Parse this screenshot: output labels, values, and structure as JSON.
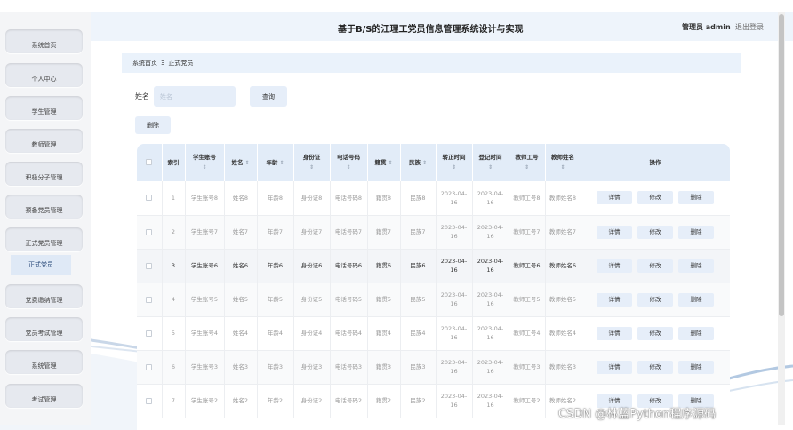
{
  "header": {
    "title": "基于B/S的江理工党员信息管理系统设计与实现",
    "admin": "管理员 admin",
    "logout": "退出登录"
  },
  "sidebar": {
    "items": [
      {
        "label": "系统首页"
      },
      {
        "label": "个人中心"
      },
      {
        "label": "学生管理"
      },
      {
        "label": "教师管理"
      },
      {
        "label": "积极分子管理"
      },
      {
        "label": "预备党员管理"
      },
      {
        "label": "正式党员管理"
      },
      {
        "label": "党费缴纳管理"
      },
      {
        "label": "党员考试管理"
      },
      {
        "label": "系统管理"
      },
      {
        "label": "考试管理"
      }
    ],
    "submenu_label": "正式党员"
  },
  "breadcrumb": {
    "home": "系统首页",
    "separator": "Ξ",
    "current": "正式党员"
  },
  "search": {
    "label": "姓名",
    "placeholder": "姓名",
    "query_button": "查询",
    "delete_button": "删除"
  },
  "table": {
    "headers": {
      "index": "索引",
      "student_no": "学生账号",
      "name": "姓名",
      "age": "年龄",
      "id_card": "身份证",
      "phone": "电话号码",
      "native": "籍贯",
      "ethnic": "民族",
      "cert_time": "转正时间",
      "reg_time": "登记时间",
      "teacher_no": "教师工号",
      "teacher_name": "教师姓名",
      "ops": "操作"
    },
    "sort_glyph": "⇕",
    "op_labels": {
      "detail": "详情",
      "edit": "修改",
      "delete": "删除"
    },
    "rows": [
      {
        "index": "1",
        "student_no": "学生账号8",
        "name": "姓名8",
        "age": "年龄8",
        "id_card": "身份证8",
        "phone": "电话号码8",
        "native": "籍贯8",
        "ethnic": "民族8",
        "cert_time": "2023-04-16",
        "reg_time": "2023-04-16",
        "teacher_no": "教师工号8",
        "teacher_name": "教师姓名8"
      },
      {
        "index": "2",
        "student_no": "学生账号7",
        "name": "姓名7",
        "age": "年龄7",
        "id_card": "身份证7",
        "phone": "电话号码7",
        "native": "籍贯7",
        "ethnic": "民族7",
        "cert_time": "2023-04-16",
        "reg_time": "2023-04-16",
        "teacher_no": "教师工号7",
        "teacher_name": "教师姓名7"
      },
      {
        "index": "3",
        "student_no": "学生账号6",
        "name": "姓名6",
        "age": "年龄6",
        "id_card": "身份证6",
        "phone": "电话号码6",
        "native": "籍贯6",
        "ethnic": "民族6",
        "cert_time": "2023-04-16",
        "reg_time": "2023-04-16",
        "teacher_no": "教师工号6",
        "teacher_name": "教师姓名6"
      },
      {
        "index": "4",
        "student_no": "学生账号5",
        "name": "姓名5",
        "age": "年龄5",
        "id_card": "身份证5",
        "phone": "电话号码5",
        "native": "籍贯5",
        "ethnic": "民族5",
        "cert_time": "2023-04-16",
        "reg_time": "2023-04-16",
        "teacher_no": "教师工号5",
        "teacher_name": "教师姓名5"
      },
      {
        "index": "5",
        "student_no": "学生账号4",
        "name": "姓名4",
        "age": "年龄4",
        "id_card": "身份证4",
        "phone": "电话号码4",
        "native": "籍贯4",
        "ethnic": "民族4",
        "cert_time": "2023-04-16",
        "reg_time": "2023-04-16",
        "teacher_no": "教师工号4",
        "teacher_name": "教师姓名4"
      },
      {
        "index": "6",
        "student_no": "学生账号3",
        "name": "姓名3",
        "age": "年龄3",
        "id_card": "身份证3",
        "phone": "电话号码3",
        "native": "籍贯3",
        "ethnic": "民族3",
        "cert_time": "2023-04-16",
        "reg_time": "2023-04-16",
        "teacher_no": "教师工号3",
        "teacher_name": "教师姓名3"
      },
      {
        "index": "7",
        "student_no": "学生账号2",
        "name": "姓名2",
        "age": "年龄2",
        "id_card": "身份证2",
        "phone": "电话号码2",
        "native": "籍贯2",
        "ethnic": "民族2",
        "cert_time": "2023-04-16",
        "reg_time": "2023-04-16",
        "teacher_no": "教师工号2",
        "teacher_name": "教师姓名2"
      }
    ]
  },
  "watermark": "CSDN @林蓝Python程序源码",
  "colors": {
    "header_bg": "#eef4fb",
    "table_header_bg": "#e2ecf8",
    "button_bg": "#e6eef9",
    "sidebar_button_bg": "#e6e9ef"
  }
}
